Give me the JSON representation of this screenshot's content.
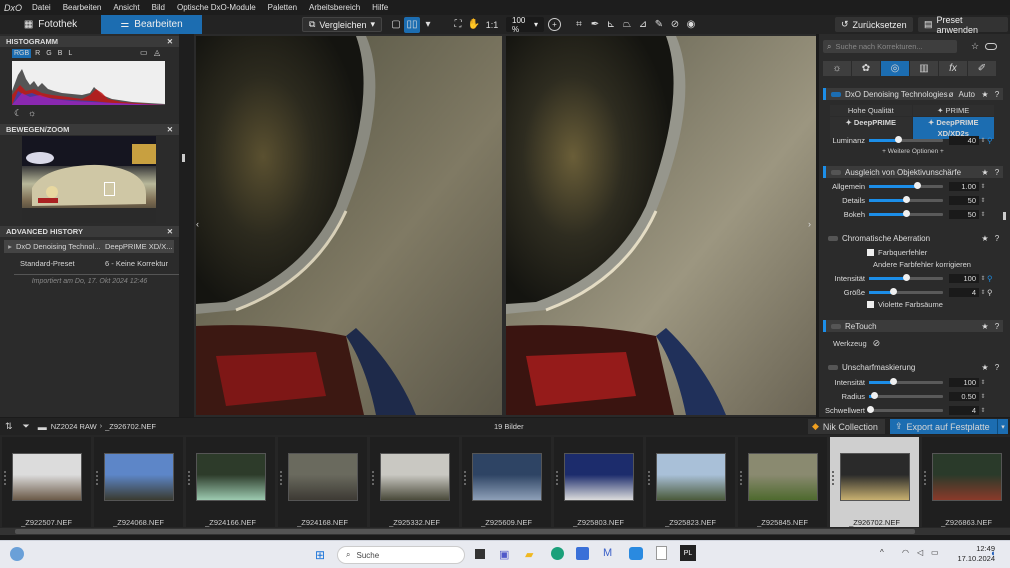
{
  "menubar": {
    "logo": "DxO",
    "items": [
      "Datei",
      "Bearbeiten",
      "Ansicht",
      "Bild",
      "Optische DxO-Module",
      "Paletten",
      "Arbeitsbereich",
      "Hilfe"
    ]
  },
  "toolbar": {
    "tab_library": "Fotothek",
    "tab_edit": "Bearbeiten",
    "compare_label": "Vergleichen",
    "ratio_label": "1:1",
    "zoom_label": "100 %",
    "reset_label": "Zurücksetzen",
    "preset_label": "Preset anwenden"
  },
  "left": {
    "histogram_title": "HISTOGRAMM",
    "hist_channels": [
      "RGB",
      "R",
      "G",
      "B",
      "L"
    ],
    "move_title": "BEWEGEN/ZOOM",
    "history_title": "ADVANCED HISTORY",
    "history": [
      {
        "name": "DxO Denoising Technol...",
        "value": "DeepPRIME XD/X..."
      },
      {
        "name": "Standard-Preset",
        "value": "6 - Keine Korrektur"
      }
    ],
    "imported": "Importiert am Do, 17. Okt 2024 12:46"
  },
  "right": {
    "search_placeholder": "Suche nach Korrekturen...",
    "denoise": {
      "title": "DxO Denoising Technologies",
      "auto": "Auto",
      "modes": [
        "Hohe Qualität",
        "PRIME",
        "DeepPRIME",
        "DeepPRIME XD/XD2s"
      ],
      "luminance_label": "Luminanz",
      "luminance_value": "40",
      "more": "+ Weitere Optionen +"
    },
    "lens": {
      "title": "Ausgleich von Objektivunschärfe",
      "rows": [
        {
          "label": "Allgemein",
          "value": "1.00",
          "level": 0.65
        },
        {
          "label": "Details",
          "value": "50",
          "level": 0.5
        },
        {
          "label": "Bokeh",
          "value": "50",
          "level": 0.5
        }
      ]
    },
    "chroma": {
      "title": "Chromatische Aberration",
      "chk1": "Farbquerfehler",
      "other": "Andere Farbfehler korrigieren",
      "intensity_label": "Intensität",
      "intensity_value": "100",
      "intensity_level": 0.5,
      "size_label": "Größe",
      "size_value": "4",
      "size_level": 0.33,
      "chk2": "Violette Farbsäume"
    },
    "retouch": {
      "title": "ReTouch",
      "tool": "Werkzeug"
    },
    "unsharp": {
      "title": "Unscharfmaskierung",
      "rows": [
        {
          "label": "Intensität",
          "value": "100",
          "level": 0.33
        },
        {
          "label": "Radius",
          "value": "0.50",
          "level": 0.08
        },
        {
          "label": "Schwellwert",
          "value": "4",
          "level": 0.02
        }
      ]
    }
  },
  "filmstrip": {
    "folder": "NZ2024 RAW",
    "file": "_Z926702.NEF",
    "count": "19 Bilder",
    "nik_label": "Nik Collection",
    "export_label": "Export auf Festplatte",
    "thumbs": [
      {
        "name": "_Z922507.NEF",
        "c1": "#dcdcdc",
        "c2": "#6b5a48"
      },
      {
        "name": "_Z924068.NEF",
        "c1": "#5d86c8",
        "c2": "#3a3a30"
      },
      {
        "name": "_Z924166.NEF",
        "c1": "#2d3b2a",
        "c2": "#9ccab0"
      },
      {
        "name": "_Z924168.NEF",
        "c1": "#6a6a5e",
        "c2": "#3d3a34"
      },
      {
        "name": "_Z925332.NEF",
        "c1": "#c9c8c2",
        "c2": "#4a4a3a"
      },
      {
        "name": "_Z925609.NEF",
        "c1": "#2e4464",
        "c2": "#8ea0b8"
      },
      {
        "name": "_Z925803.NEF",
        "c1": "#1c2c6c",
        "c2": "#dcdcdc"
      },
      {
        "name": "_Z925823.NEF",
        "c1": "#a9c0d8",
        "c2": "#4a5a3a"
      },
      {
        "name": "_Z925845.NEF",
        "c1": "#8a8a70",
        "c2": "#4e6a2e"
      },
      {
        "name": "_Z926702.NEF",
        "c1": "#2a2a2a",
        "c2": "#c8b070"
      },
      {
        "name": "_Z926863.NEF",
        "c1": "#2a3a2a",
        "c2": "#8a3a2a"
      }
    ]
  },
  "taskbar": {
    "search": "Suche",
    "time": "12:49",
    "date": "17.10.2024"
  }
}
